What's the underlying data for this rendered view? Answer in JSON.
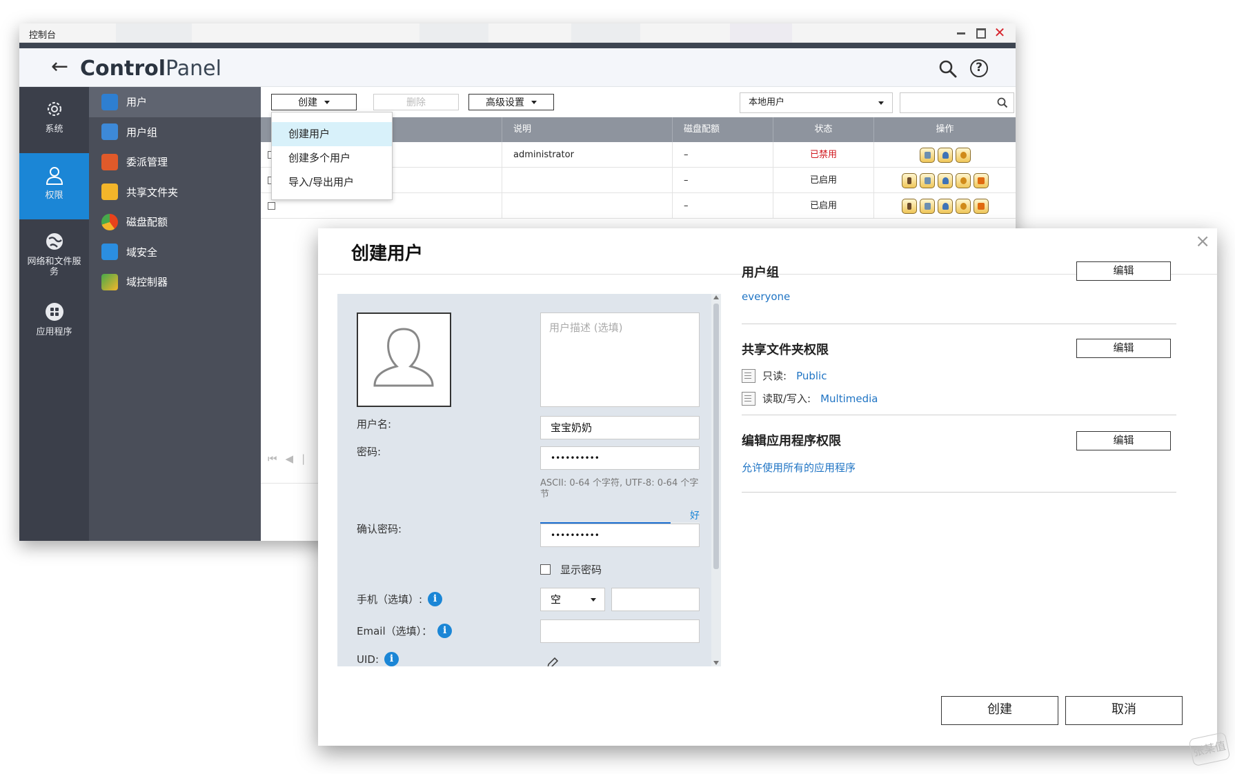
{
  "window": {
    "title": "控制台",
    "brand_bold": "Control",
    "brand_light": "Panel"
  },
  "leftbar": {
    "items": [
      {
        "label": "系统",
        "icon": "gear-icon"
      },
      {
        "label": "权限",
        "icon": "user-icon",
        "active": true
      },
      {
        "label": "网络和文件服务",
        "icon": "globe-icon"
      },
      {
        "label": "应用程序",
        "icon": "apps-icon"
      }
    ]
  },
  "subnav": {
    "items": [
      {
        "label": "用户",
        "icon": "user-icon",
        "color": "#2e7fd1",
        "active": true
      },
      {
        "label": "用户组",
        "icon": "user-group-icon",
        "color": "#3d89d8"
      },
      {
        "label": "委派管理",
        "icon": "delegate-icon",
        "color": "#e05a2a"
      },
      {
        "label": "共享文件夹",
        "icon": "folder-icon",
        "color": "#f3b52a"
      },
      {
        "label": "磁盘配额",
        "icon": "quota-pie-icon",
        "color": "#e8431b"
      },
      {
        "label": "域安全",
        "icon": "domain-security-icon",
        "color": "#2b8ee0"
      },
      {
        "label": "域控制器",
        "icon": "domain-controller-icon",
        "color": "#47a94b"
      }
    ]
  },
  "toolbar": {
    "create_label": "创建",
    "delete_label": "删除",
    "advanced_label": "高级设置",
    "user_type_selected": "本地用户",
    "search_value": ""
  },
  "create_menu": {
    "items": [
      "创建用户",
      "创建多个用户",
      "导入/导出用户"
    ]
  },
  "grid": {
    "headers": {
      "description": "说明",
      "quota": "磁盘配额",
      "status": "状态",
      "actions": "操作"
    },
    "rows": [
      {
        "description": "administrator",
        "quota": "–",
        "status": "已禁用",
        "disabled": true
      },
      {
        "description": "",
        "quota": "–",
        "status": "已启用",
        "disabled": false
      },
      {
        "description": "",
        "quota": "–",
        "status": "已启用",
        "disabled": false
      }
    ]
  },
  "dialog": {
    "title": "创建用户",
    "close_glyph": "×",
    "form": {
      "description_placeholder": "用户描述 (选填)",
      "username_label": "用户名:",
      "username_value": "宝宝奶奶",
      "password_label": "密码:",
      "password_value": "••••••••••",
      "password_hint": "ASCII: 0-64 个字符, UTF-8: 0-64 个字节",
      "strength_label": "好",
      "strength_level": 0.82,
      "confirm_label": "确认密码:",
      "confirm_value": "••••••••••",
      "show_password_label": "显示密码",
      "phone_label": "手机（选填）:",
      "phone_country": "空",
      "email_label": "Email（选填）：",
      "uid_label": "UID:"
    },
    "groups": {
      "title": "用户组",
      "edit_label": "编辑",
      "value": "everyone"
    },
    "shared_folders": {
      "title": "共享文件夹权限",
      "edit_label": "编辑",
      "readonly_label": "只读:",
      "readonly_value": "Public",
      "readwrite_label": "读取/写入:",
      "readwrite_value": "Multimedia"
    },
    "app_perms": {
      "title": "编辑应用程序权限",
      "edit_label": "编辑",
      "value": "允许使用所有的应用程序"
    },
    "create_button": "创建",
    "cancel_button": "取消"
  },
  "watermark": "张某值",
  "colors": {
    "accent": "#1b86d6",
    "sidebar_dark": "#3b3f4a",
    "subnav": "#4a4e59",
    "disabled_status": "#d0161c",
    "link": "#1f74c4"
  }
}
